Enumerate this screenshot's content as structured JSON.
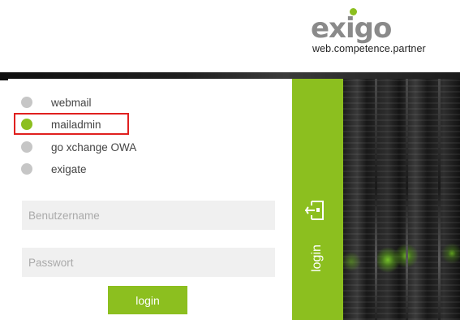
{
  "header": {
    "logo_text": "exigo",
    "tagline": "web.competence.partner"
  },
  "services": [
    {
      "label": "webmail",
      "selected": false
    },
    {
      "label": "mailadmin",
      "selected": true
    },
    {
      "label": "go xchange OWA",
      "selected": false
    },
    {
      "label": "exigate",
      "selected": false
    }
  ],
  "form": {
    "username_placeholder": "Benutzername",
    "password_placeholder": "Passwort",
    "login_button": "login"
  },
  "side_tab": {
    "label": "login",
    "icon": "login-door-icon"
  },
  "colors": {
    "accent_green": "#8cbf1f",
    "radio_inactive": "#c6c6c6",
    "highlight_red": "#e0201f",
    "input_bg": "#f0f0f0"
  }
}
